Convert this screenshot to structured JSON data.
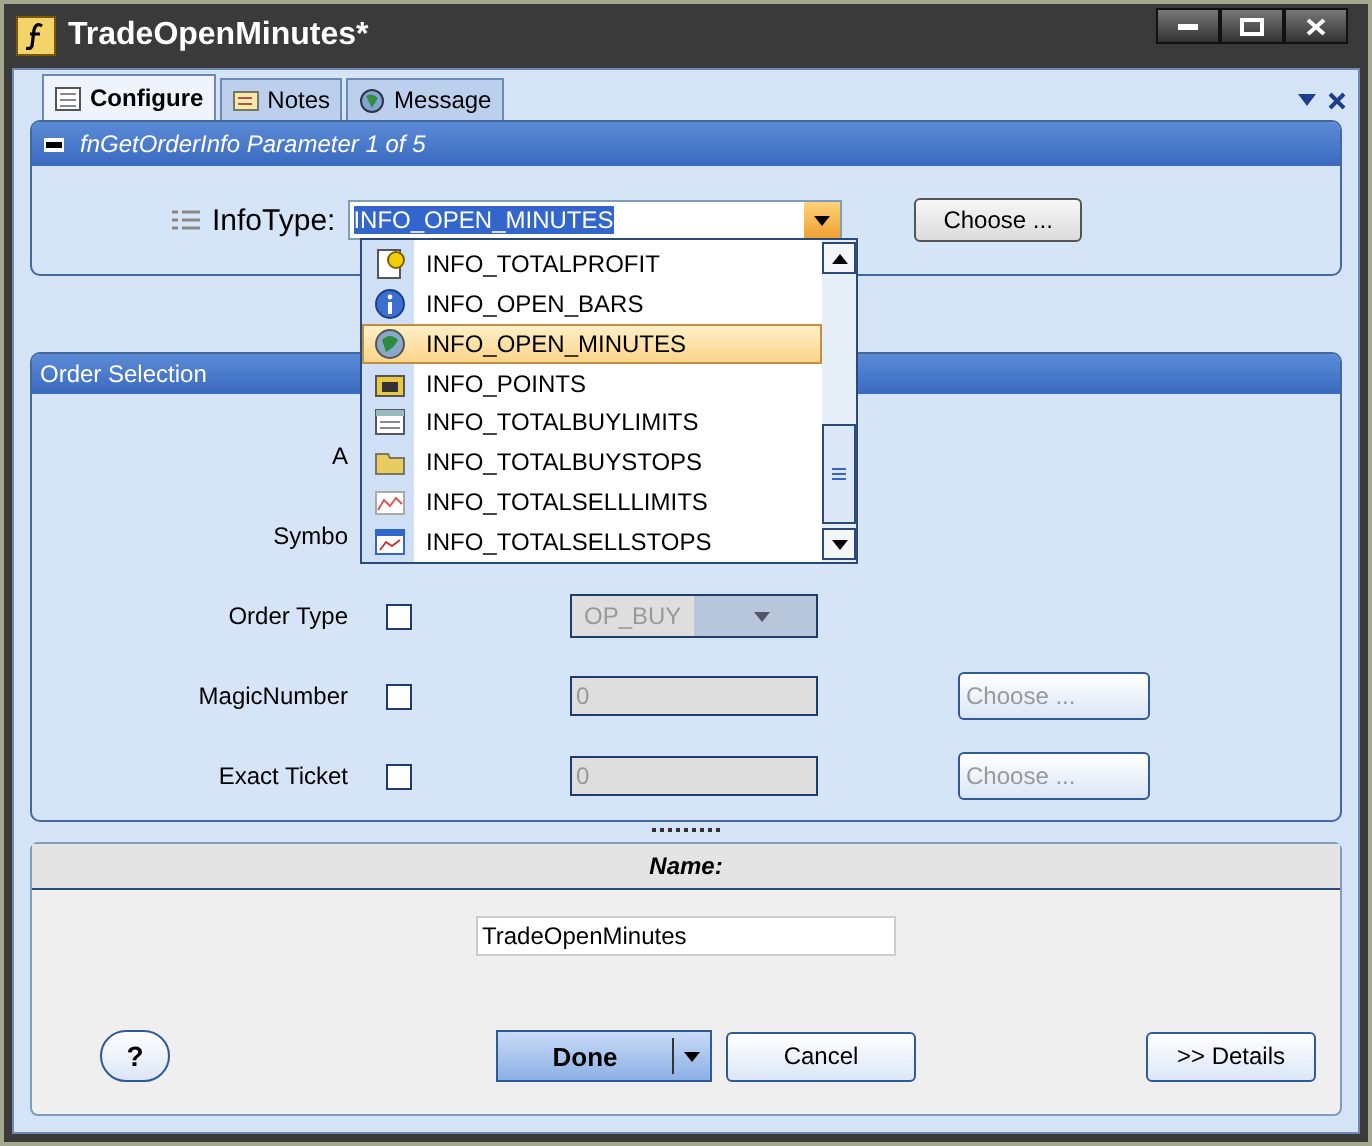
{
  "window": {
    "title": "TradeOpenMinutes*"
  },
  "tabs": [
    {
      "label": "Configure",
      "selected": true
    },
    {
      "label": "Notes",
      "selected": false
    },
    {
      "label": "Message",
      "selected": false
    }
  ],
  "parameter_panel": {
    "title": "fnGetOrderInfo  Parameter 1 of 5",
    "label": "InfoType:",
    "value": "INFO_OPEN_MINUTES",
    "button": "Choose ..."
  },
  "dropdown": {
    "items": [
      {
        "label": "INFO_TOTALPROFIT",
        "selected": false
      },
      {
        "label": "INFO_OPEN_BARS",
        "selected": false
      },
      {
        "label": "INFO_OPEN_MINUTES",
        "selected": true
      },
      {
        "label": "INFO_POINTS",
        "selected": false
      },
      {
        "label": "INFO_TOTALBUYLIMITS",
        "selected": false
      },
      {
        "label": "INFO_TOTALBUYSTOPS",
        "selected": false
      },
      {
        "label": "INFO_TOTALSELLLIMITS",
        "selected": false
      },
      {
        "label": "INFO_TOTALSELLSTOPS",
        "selected": false
      }
    ]
  },
  "order_selection": {
    "title": "Order Selection",
    "rows": [
      {
        "kind": "label",
        "label": "A"
      },
      {
        "kind": "label",
        "label": "Symbo"
      },
      {
        "kind": "combo",
        "label": "Order Type",
        "checked": false,
        "value": "OP_BUY",
        "disabled": true
      },
      {
        "kind": "text",
        "label": "MagicNumber",
        "checked": false,
        "value": "0",
        "disabled": true,
        "button": "Choose ..."
      },
      {
        "kind": "text",
        "label": "Exact Ticket",
        "checked": false,
        "value": "0",
        "disabled": true,
        "button": "Choose ..."
      }
    ]
  },
  "name_panel": {
    "title": "Name:",
    "value": "TradeOpenMinutes"
  },
  "buttons": {
    "help": "?",
    "done": "Done",
    "cancel": "Cancel",
    "details": ">> Details"
  }
}
